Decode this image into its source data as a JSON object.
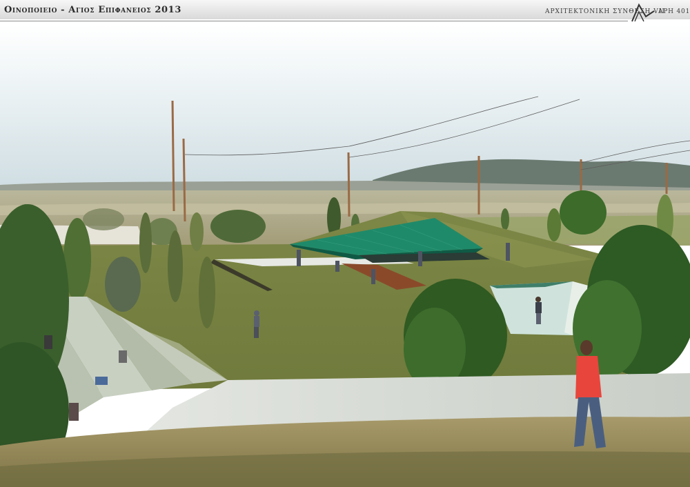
{
  "header": {
    "title": "Οινοποιειο - Αγιος Επιφανειος 2013",
    "course": "ΑΡΧΙΤΕΚΤΟΝΙΚΗ ΣΥΝΘΕΣΗ VII",
    "sheet": "ΑΡΗ 401"
  },
  "icons": {
    "logo": "architect-roof-logo-icon"
  },
  "colors": {
    "sky": "#dfe9ee",
    "grass": "#7f8748",
    "roof": "#1f8a6a",
    "deck": "#8a4a2a",
    "path": "#d8dcd6",
    "figure_jacket": "#e8453c"
  }
}
